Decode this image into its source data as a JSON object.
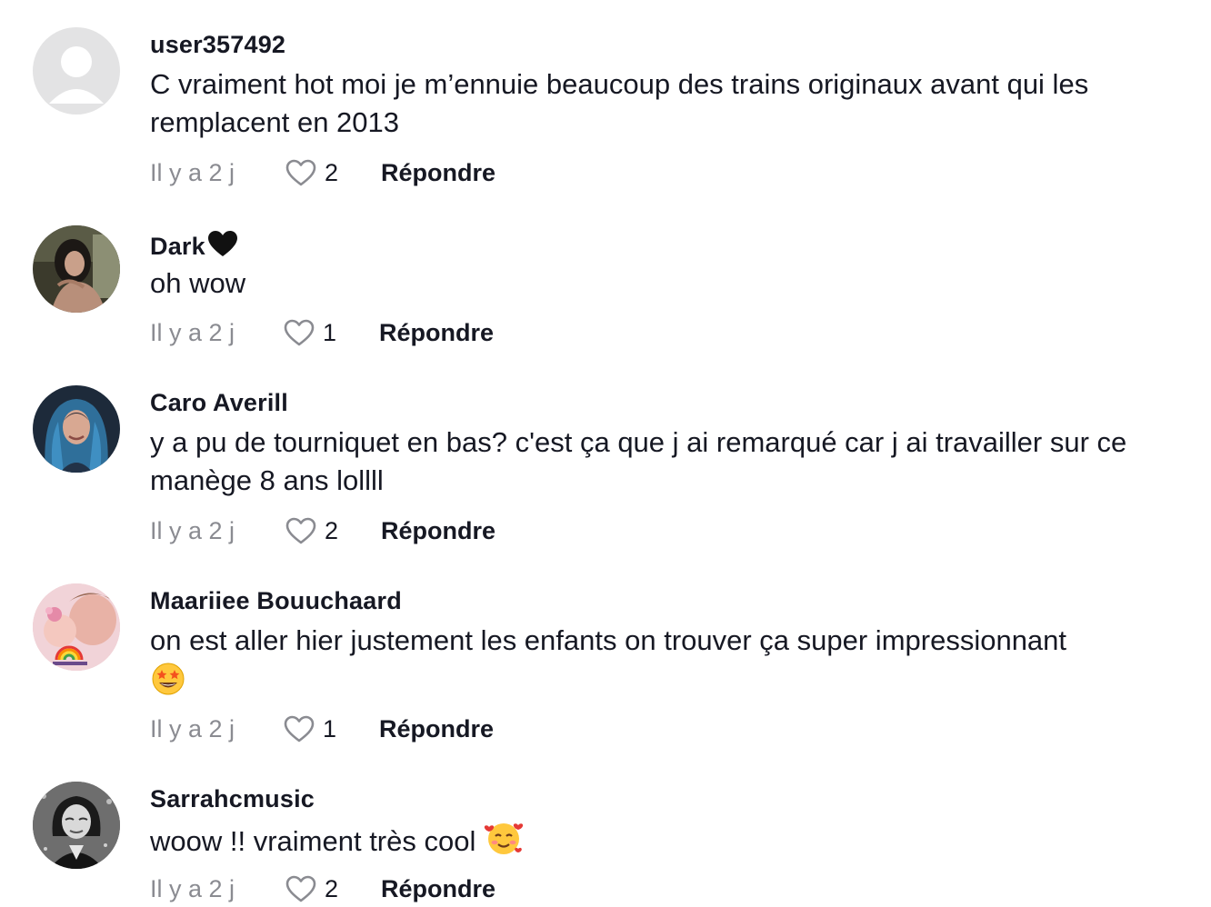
{
  "comments": [
    {
      "username": "user357492",
      "text": "C vraiment hot moi je m’ennuie beaucoup des trains originaux avant qui les remplacent en 2013",
      "timestamp": "Il y a 2 j",
      "likes": "2",
      "reply_label": "Répondre",
      "avatar": "default-avatar"
    },
    {
      "username": "Dark",
      "username_emoji": "black-heart-emoji",
      "text": "oh wow",
      "timestamp": "Il y a 2 j",
      "likes": "1",
      "reply_label": "Répondre",
      "avatar": "photo-avatar"
    },
    {
      "username": "Caro Averill",
      "text": "y a pu de tourniquet en bas? c'est ça que j ai remarqué car j ai travailler sur ce manège 8 ans lollll",
      "timestamp": "Il y a 2 j",
      "likes": "2",
      "reply_label": "Répondre",
      "avatar": "photo-avatar"
    },
    {
      "username": "Maariiee Bouuchaard",
      "text": "on est aller hier justement les enfants on trouver ça super impressionnant",
      "text_emoji": "star-struck-emoji",
      "timestamp": "Il y a 2 j",
      "likes": "1",
      "reply_label": "Répondre",
      "avatar": "photo-avatar"
    },
    {
      "username": "Sarrahcmusic",
      "text": "woow !! vraiment très cool",
      "text_emoji": "smiling-face-with-hearts-emoji",
      "timestamp": "Il y a 2 j",
      "likes": "2",
      "reply_label": "Répondre",
      "avatar": "photo-avatar"
    }
  ],
  "colors": {
    "text": "#161823",
    "muted": "#8a8b91",
    "like_icon": "#8a8b91"
  }
}
